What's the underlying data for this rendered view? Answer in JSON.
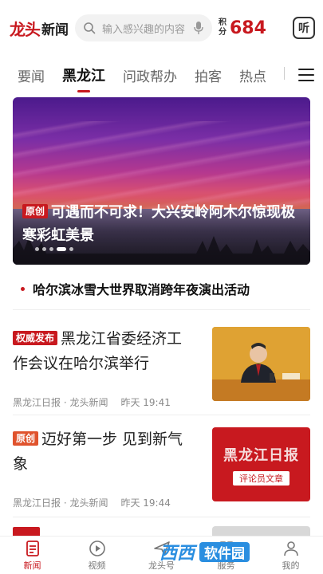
{
  "header": {
    "logo_mark": "龙头",
    "logo_text": "新闻",
    "search_placeholder": "输入感兴趣的内容",
    "points_label_top": "积",
    "points_label_bottom": "分",
    "points_value": "684",
    "listen_label": "听"
  },
  "tabs": [
    {
      "label": "要闻"
    },
    {
      "label": "黑龙江"
    },
    {
      "label": "问政帮办"
    },
    {
      "label": "拍客"
    },
    {
      "label": "热点"
    }
  ],
  "banner": {
    "tag": "原创",
    "caption": "可遇而不可求！大兴安岭阿木尔惊现极寒彩虹美景",
    "slides": 5,
    "active_slide": 4
  },
  "flash": {
    "text": "哈尔滨冰雪大世界取消跨年夜演出活动"
  },
  "news": [
    {
      "tag": "权威发布",
      "title": "黑龙江省委经济工作会议在哈尔滨举行",
      "source": "黑龙江日报 · 龙头新闻",
      "time": "昨天  19:41"
    },
    {
      "tag": "原创",
      "title": "迈好第一步 见到新气象",
      "source": "黑龙江日报 · 龙头新闻",
      "time": "昨天  19:44",
      "thumb_title": "黑龙江日报",
      "thumb_sub": "评论员文章"
    }
  ],
  "bottom_nav": [
    {
      "label": "新闻",
      "icon": "news-icon"
    },
    {
      "label": "视频",
      "icon": "video-icon"
    },
    {
      "label": "龙头号",
      "icon": "paper-plane-icon"
    },
    {
      "label": "服务",
      "icon": "service-icon"
    },
    {
      "label": "我的",
      "icon": "profile-icon"
    }
  ],
  "watermark": {
    "logo": "西西",
    "text": "软件园"
  },
  "colors": {
    "brand_red": "#c8191f",
    "tag_orange": "#e0532d",
    "watermark_blue": "#2a8ee0"
  }
}
